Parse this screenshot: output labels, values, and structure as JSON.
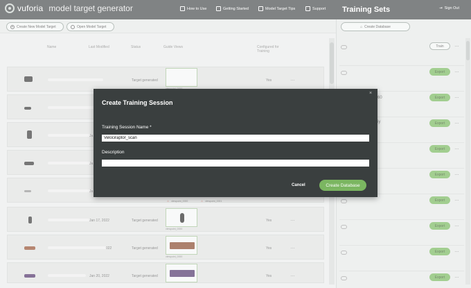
{
  "header": {
    "brand": "vuforia",
    "app_title": "model target generator",
    "nav": [
      {
        "label": "How to Use",
        "icon": "book-icon"
      },
      {
        "label": "Getting Started",
        "icon": "grid-icon"
      },
      {
        "label": "Model Target Tips",
        "icon": "grid-icon"
      },
      {
        "label": "Support",
        "icon": "help-icon"
      }
    ],
    "panel_title": "Training Sets",
    "sign_out": "Sign Out"
  },
  "toolbar": {
    "create_label": "Create New Model Target",
    "open_label": "Open Model Target"
  },
  "table": {
    "columns": [
      "Name",
      "Last Modified",
      "Status",
      "Guide Views",
      "Configured for Training"
    ],
    "rows": [
      {
        "date": "",
        "status": "Target generated",
        "view": "viewpoint_0000",
        "configured": "Yes"
      },
      {
        "date": "",
        "status": "",
        "view": "",
        "configured": ""
      },
      {
        "date": "Ja",
        "status": "",
        "view": "",
        "configured": ""
      },
      {
        "date": "Ja",
        "status": "",
        "view": "",
        "configured": ""
      },
      {
        "date": "Ja",
        "status": "",
        "view": "",
        "configured": "",
        "warnings": [
          "viewpoint_0000",
          "viewpoint_0001"
        ]
      },
      {
        "date": "Jan 17, 2022",
        "status": "Target generated",
        "view": "viewpoint_0000",
        "configured": "Yes"
      },
      {
        "date": "022",
        "status": "Target generated",
        "view": "viewpoint_0000",
        "configured": "Yes"
      },
      {
        "date": "Jan 20, 2022",
        "status": "Target generated",
        "view": "",
        "configured": "Yes"
      }
    ]
  },
  "right_panel": {
    "create_db_label": "Create Database",
    "rows": [
      {
        "action": "Train",
        "partial": ""
      },
      {
        "action": "Export",
        "partial": ""
      },
      {
        "action": "Export",
        "partial": "60"
      },
      {
        "action": "Export",
        "partial": "iy"
      },
      {
        "action": "Export",
        "partial": ""
      },
      {
        "action": "Export",
        "partial": ""
      },
      {
        "action": "Export",
        "partial": ""
      },
      {
        "action": "Export",
        "partial": ""
      },
      {
        "action": "Export",
        "partial": ""
      },
      {
        "action": "Export",
        "partial": ""
      }
    ]
  },
  "modal": {
    "title": "Create Training Session",
    "close": "×",
    "name_label": "Training Session Name *",
    "name_value": "Velociraptor_scan",
    "desc_label": "Description",
    "desc_value": "",
    "cancel": "Cancel",
    "create": "Create Database"
  },
  "colors": {
    "header": "#333839",
    "modal": "#3a3f3f",
    "accent": "#7bb661"
  }
}
